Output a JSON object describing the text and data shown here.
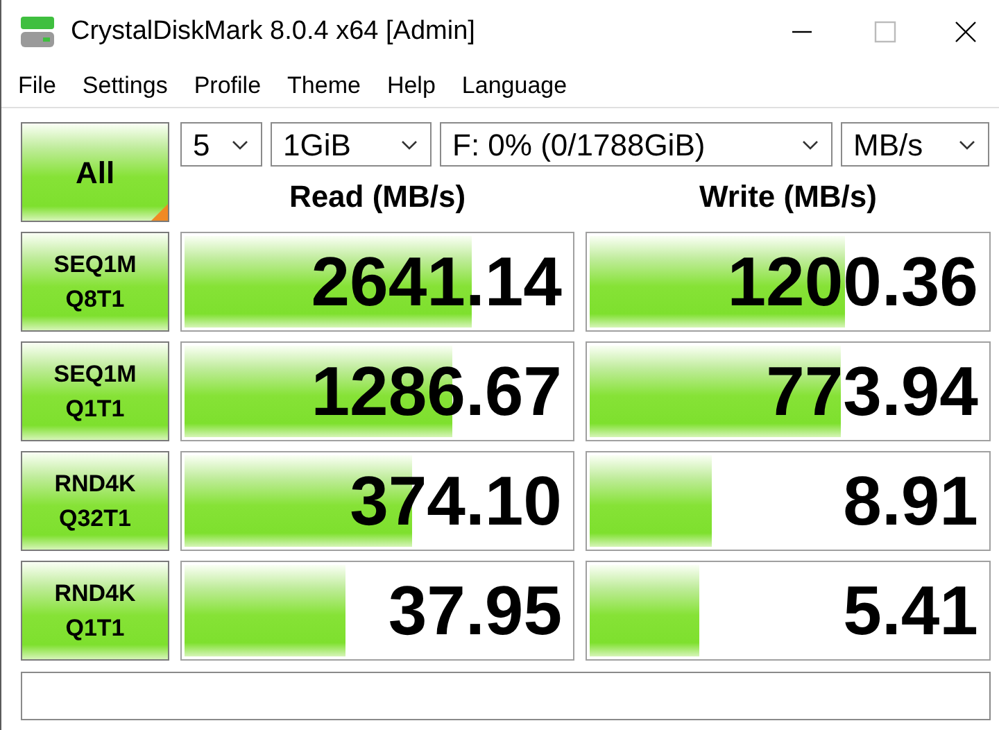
{
  "window": {
    "title": "CrystalDiskMark 8.0.4 x64 [Admin]"
  },
  "menu": [
    "File",
    "Settings",
    "Profile",
    "Theme",
    "Help",
    "Language"
  ],
  "all_button": "All",
  "selects": {
    "count": "5",
    "size": "1GiB",
    "drive": "F: 0% (0/1788GiB)",
    "unit": "MB/s"
  },
  "columns": [
    "Read (MB/s)",
    "Write (MB/s)"
  ],
  "tests": [
    {
      "line1": "SEQ1M",
      "line2": "Q8T1",
      "read": {
        "value": "2641.14",
        "level": 0.74
      },
      "write": {
        "value": "1200.36",
        "level": 0.64
      }
    },
    {
      "line1": "SEQ1M",
      "line2": "Q1T1",
      "read": {
        "value": "1286.67",
        "level": 0.69
      },
      "write": {
        "value": "773.94",
        "level": 0.63
      }
    },
    {
      "line1": "RND4K",
      "line2": "Q32T1",
      "read": {
        "value": "374.10",
        "level": 0.59
      },
      "write": {
        "value": "8.91",
        "level": 0.31
      }
    },
    {
      "line1": "RND4K",
      "line2": "Q1T1",
      "read": {
        "value": "37.95",
        "level": 0.42
      },
      "write": {
        "value": "5.41",
        "level": 0.28
      }
    }
  ]
}
